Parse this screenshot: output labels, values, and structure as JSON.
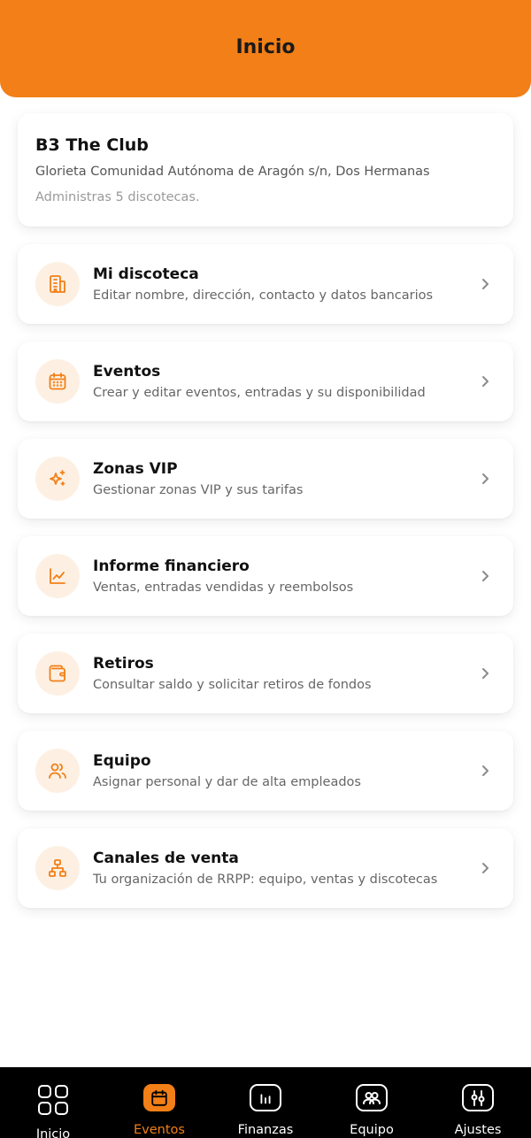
{
  "header": {
    "title": "Inicio"
  },
  "venue": {
    "name": "B3 The Club",
    "address": "Glorieta Comunidad Autónoma de Aragón s/n, Dos Hermanas",
    "managed_count": "Administras 5 discotecas."
  },
  "menu": [
    {
      "title": "Mi discoteca",
      "subtitle": "Editar nombre, dirección, contacto y datos bancarios",
      "icon": "building-icon"
    },
    {
      "title": "Eventos",
      "subtitle": "Crear y editar eventos, entradas y su disponibilidad",
      "icon": "calendar-icon"
    },
    {
      "title": "Zonas VIP",
      "subtitle": "Gestionar zonas VIP y sus tarifas",
      "icon": "sparkles-icon"
    },
    {
      "title": "Informe financiero",
      "subtitle": "Ventas, entradas vendidas y reembolsos",
      "icon": "line-chart-icon"
    },
    {
      "title": "Retiros",
      "subtitle": "Consultar saldo y solicitar retiros de fondos",
      "icon": "wallet-icon"
    },
    {
      "title": "Equipo",
      "subtitle": "Asignar personal y dar de alta empleados",
      "icon": "users-icon"
    },
    {
      "title": "Canales de venta",
      "subtitle": "Tu organización de RRPP: equipo, ventas y discotecas",
      "icon": "network-icon"
    }
  ],
  "nav": [
    {
      "label": "Inicio",
      "icon": "grid-icon",
      "active": false
    },
    {
      "label": "Eventos",
      "icon": "calendar-icon",
      "active": true
    },
    {
      "label": "Finanzas",
      "icon": "bar-chart-icon",
      "active": false
    },
    {
      "label": "Equipo",
      "icon": "users-icon",
      "active": false
    },
    {
      "label": "Ajustes",
      "icon": "sliders-icon",
      "active": false
    }
  ],
  "colors": {
    "accent": "#f27f17",
    "icon_bg": "#fdf0e3",
    "nav_bg": "#000000"
  }
}
